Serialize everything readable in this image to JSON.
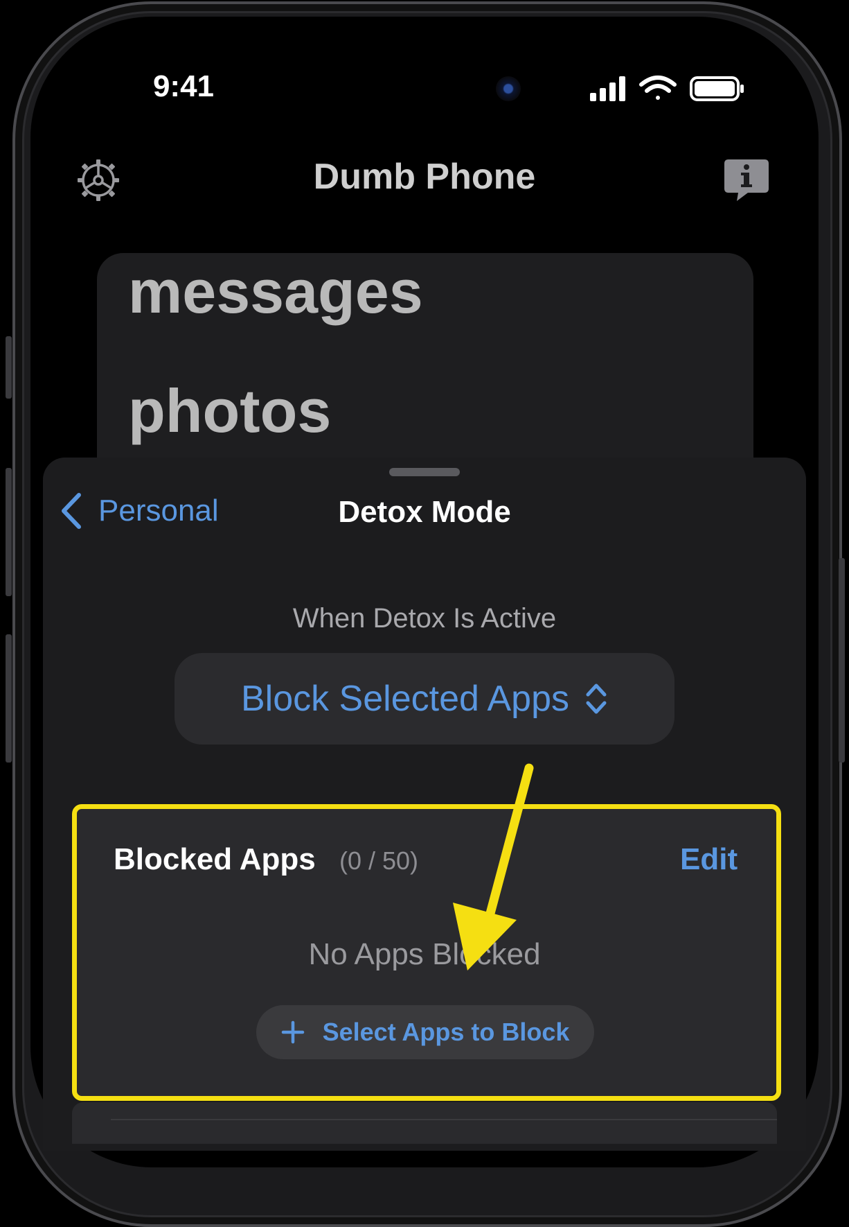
{
  "status_bar": {
    "time": "9:41"
  },
  "nav": {
    "title": "Dumb Phone"
  },
  "background_list": {
    "items": [
      "messages",
      "photos"
    ]
  },
  "sheet": {
    "back_label": "Personal",
    "title": "Detox Mode",
    "section_caption": "When Detox Is Active",
    "picker_value": "Block Selected Apps"
  },
  "blocked_apps": {
    "title": "Blocked Apps",
    "count": "(0 / 50)",
    "edit_label": "Edit",
    "empty_label": "No Apps Blocked",
    "select_button_label": "Select Apps to Block"
  },
  "colors": {
    "accent": "#5a97e0",
    "highlight": "#f5df12",
    "sheet_bg": "#1c1c1e",
    "card_bg": "#2a2a2d"
  },
  "icons": [
    "gear-icon",
    "info-bubble-icon",
    "chevron-left-icon",
    "up-down-chevron-icon",
    "plus-icon",
    "signal-icon",
    "wifi-icon",
    "battery-icon"
  ]
}
